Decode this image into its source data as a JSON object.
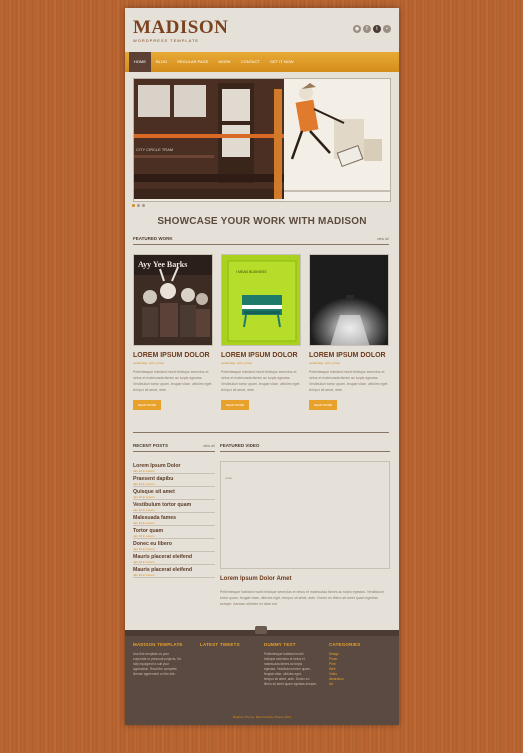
{
  "brand": {
    "name": "MADISON",
    "tagline": "WORDPRESS TEMPLATE"
  },
  "social": [
    "rss",
    "facebook",
    "twitter",
    "flickr"
  ],
  "nav": [
    {
      "label": "HOME",
      "active": true
    },
    {
      "label": "BLOG",
      "active": false
    },
    {
      "label": "REGULAR PAGE",
      "active": false
    },
    {
      "label": "WORK",
      "active": false
    },
    {
      "label": "CONTACT",
      "active": false
    },
    {
      "label": "GET IT NOW",
      "active": false
    }
  ],
  "slider": {
    "tram_caption": "CITY CIRCLE TRAM"
  },
  "showcase_heading": "SHOWCASE YOUR WORK WITH MADISON",
  "featured_work": {
    "heading": "FEATURED WORK",
    "view_all": "view all",
    "items": [
      {
        "title": "LOREM IPSUM DOLOR",
        "meta": "webdesign, print, photo",
        "desc": "Pellentesque habitant morbi tristique senectus et netus et malesuada fames ac turpis egestas. Vestibulum tortor quam, feugiat vitae, ultricies eget, tempor sit amet, ante.",
        "more": "READ MORE",
        "art_text": "Ayy Yee Barks"
      },
      {
        "title": "LOREM IPSUM DOLOR",
        "meta": "webdesign, print, photo",
        "desc": "Pellentesque habitant morbi tristique senectus et netus et malesuada fames ac turpis egestas. Vestibulum tortor quam, feugiat vitae, ultricies eget, tempor sit amet, ante.",
        "more": "READ MORE",
        "art_text": "I MEAN BUSINESS"
      },
      {
        "title": "LOREM IPSUM DOLOR",
        "meta": "webdesign, print, photo",
        "desc": "Pellentesque habitant morbi tristique senectus et netus et malesuada fames ac turpis egestas. Vestibulum tortor quam, feugiat vitae, ultricies eget, tempor sit amet, ante.",
        "more": "READ MORE",
        "art_text": ""
      }
    ]
  },
  "recent_posts": {
    "heading": "RECENT POSTS",
    "view_all": "view all",
    "items": [
      {
        "title": "Lorem Ipsum Dolor",
        "date": "Jan 10 in Lorem"
      },
      {
        "title": "Praesent dapibu",
        "date": "Jan 10 in Lorem"
      },
      {
        "title": "Quisque sit amet",
        "date": "Jan 10 in Lorem"
      },
      {
        "title": "Vestibulum tortor quam",
        "date": "Jan 10 in Lorem"
      },
      {
        "title": "Malesuada fames",
        "date": "Jan 10 in Lorem"
      },
      {
        "title": "Tortor quam",
        "date": "Jan 10 in Lorem"
      },
      {
        "title": "Donec eu libero",
        "date": "Jan 10 in Lorem"
      },
      {
        "title": "Mauris placerat eleifend",
        "date": "Jan 10 in Lorem"
      },
      {
        "title": "Mauris placerat eleifend",
        "date": "Jan 10 in Lorem"
      }
    ]
  },
  "featured_video": {
    "heading": "FEATURED VIDEO",
    "placeholder": "video",
    "title": "Lorem Ipsum Dolor Amet",
    "desc": "Pellentesque habitant morbi tristique senectus et netus et malesuada fames ac turpis egestas. Vestibulum tortor quam, feugiat vitae, ultricies eget, tempor sit amet, ante. Donec eu libero sit amet quam egestas semper. Aenean ultricies mi vitae est."
  },
  "footer": {
    "col1": {
      "heading": "MADISON TEMPLATE",
      "text": "Use this template on your\ncorporate or personal projects, it's\nfully equipped to suit your\napplication. Read the complete\nlicense agreement on the site."
    },
    "col2": {
      "heading": "LATEST TWEETS"
    },
    "col3": {
      "heading": "DUMMY TEXT",
      "text": "Pellentesque habitant morbi\ntristique senectus et netus et\nmalesuada fames ac turpis\negestas. Vestibulum tortor quam,\nfeugiat vitae, ultricies eget,\ntempor sit amet, ante. Donec eu\nlibero sit amet quam egestas semper."
    },
    "col4": {
      "heading": "CATEGORIES",
      "items": [
        "Design",
        "Photo",
        "Print",
        "Web",
        "Video",
        "Illustration",
        "Art"
      ]
    },
    "copyright": "Madison Theme, Best Portfolio Theme 2012"
  },
  "colors": {
    "accent": "#e8a12b",
    "brand": "#7a4320",
    "footer_bg": "#5a4a42",
    "page_bg": "#e6e1d8",
    "wood": "#b9642f"
  }
}
